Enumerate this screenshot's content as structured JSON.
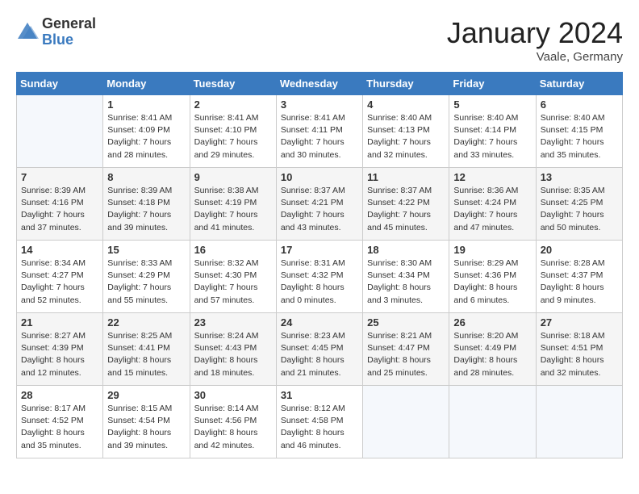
{
  "header": {
    "logo_general": "General",
    "logo_blue": "Blue",
    "month_title": "January 2024",
    "location": "Vaale, Germany"
  },
  "days_of_week": [
    "Sunday",
    "Monday",
    "Tuesday",
    "Wednesday",
    "Thursday",
    "Friday",
    "Saturday"
  ],
  "weeks": [
    [
      {
        "day": "",
        "empty": true
      },
      {
        "day": "1",
        "sunrise": "Sunrise: 8:41 AM",
        "sunset": "Sunset: 4:09 PM",
        "daylight": "Daylight: 7 hours and 28 minutes."
      },
      {
        "day": "2",
        "sunrise": "Sunrise: 8:41 AM",
        "sunset": "Sunset: 4:10 PM",
        "daylight": "Daylight: 7 hours and 29 minutes."
      },
      {
        "day": "3",
        "sunrise": "Sunrise: 8:41 AM",
        "sunset": "Sunset: 4:11 PM",
        "daylight": "Daylight: 7 hours and 30 minutes."
      },
      {
        "day": "4",
        "sunrise": "Sunrise: 8:40 AM",
        "sunset": "Sunset: 4:13 PM",
        "daylight": "Daylight: 7 hours and 32 minutes."
      },
      {
        "day": "5",
        "sunrise": "Sunrise: 8:40 AM",
        "sunset": "Sunset: 4:14 PM",
        "daylight": "Daylight: 7 hours and 33 minutes."
      },
      {
        "day": "6",
        "sunrise": "Sunrise: 8:40 AM",
        "sunset": "Sunset: 4:15 PM",
        "daylight": "Daylight: 7 hours and 35 minutes."
      }
    ],
    [
      {
        "day": "7",
        "sunrise": "Sunrise: 8:39 AM",
        "sunset": "Sunset: 4:16 PM",
        "daylight": "Daylight: 7 hours and 37 minutes."
      },
      {
        "day": "8",
        "sunrise": "Sunrise: 8:39 AM",
        "sunset": "Sunset: 4:18 PM",
        "daylight": "Daylight: 7 hours and 39 minutes."
      },
      {
        "day": "9",
        "sunrise": "Sunrise: 8:38 AM",
        "sunset": "Sunset: 4:19 PM",
        "daylight": "Daylight: 7 hours and 41 minutes."
      },
      {
        "day": "10",
        "sunrise": "Sunrise: 8:37 AM",
        "sunset": "Sunset: 4:21 PM",
        "daylight": "Daylight: 7 hours and 43 minutes."
      },
      {
        "day": "11",
        "sunrise": "Sunrise: 8:37 AM",
        "sunset": "Sunset: 4:22 PM",
        "daylight": "Daylight: 7 hours and 45 minutes."
      },
      {
        "day": "12",
        "sunrise": "Sunrise: 8:36 AM",
        "sunset": "Sunset: 4:24 PM",
        "daylight": "Daylight: 7 hours and 47 minutes."
      },
      {
        "day": "13",
        "sunrise": "Sunrise: 8:35 AM",
        "sunset": "Sunset: 4:25 PM",
        "daylight": "Daylight: 7 hours and 50 minutes."
      }
    ],
    [
      {
        "day": "14",
        "sunrise": "Sunrise: 8:34 AM",
        "sunset": "Sunset: 4:27 PM",
        "daylight": "Daylight: 7 hours and 52 minutes."
      },
      {
        "day": "15",
        "sunrise": "Sunrise: 8:33 AM",
        "sunset": "Sunset: 4:29 PM",
        "daylight": "Daylight: 7 hours and 55 minutes."
      },
      {
        "day": "16",
        "sunrise": "Sunrise: 8:32 AM",
        "sunset": "Sunset: 4:30 PM",
        "daylight": "Daylight: 7 hours and 57 minutes."
      },
      {
        "day": "17",
        "sunrise": "Sunrise: 8:31 AM",
        "sunset": "Sunset: 4:32 PM",
        "daylight": "Daylight: 8 hours and 0 minutes."
      },
      {
        "day": "18",
        "sunrise": "Sunrise: 8:30 AM",
        "sunset": "Sunset: 4:34 PM",
        "daylight": "Daylight: 8 hours and 3 minutes."
      },
      {
        "day": "19",
        "sunrise": "Sunrise: 8:29 AM",
        "sunset": "Sunset: 4:36 PM",
        "daylight": "Daylight: 8 hours and 6 minutes."
      },
      {
        "day": "20",
        "sunrise": "Sunrise: 8:28 AM",
        "sunset": "Sunset: 4:37 PM",
        "daylight": "Daylight: 8 hours and 9 minutes."
      }
    ],
    [
      {
        "day": "21",
        "sunrise": "Sunrise: 8:27 AM",
        "sunset": "Sunset: 4:39 PM",
        "daylight": "Daylight: 8 hours and 12 minutes."
      },
      {
        "day": "22",
        "sunrise": "Sunrise: 8:25 AM",
        "sunset": "Sunset: 4:41 PM",
        "daylight": "Daylight: 8 hours and 15 minutes."
      },
      {
        "day": "23",
        "sunrise": "Sunrise: 8:24 AM",
        "sunset": "Sunset: 4:43 PM",
        "daylight": "Daylight: 8 hours and 18 minutes."
      },
      {
        "day": "24",
        "sunrise": "Sunrise: 8:23 AM",
        "sunset": "Sunset: 4:45 PM",
        "daylight": "Daylight: 8 hours and 21 minutes."
      },
      {
        "day": "25",
        "sunrise": "Sunrise: 8:21 AM",
        "sunset": "Sunset: 4:47 PM",
        "daylight": "Daylight: 8 hours and 25 minutes."
      },
      {
        "day": "26",
        "sunrise": "Sunrise: 8:20 AM",
        "sunset": "Sunset: 4:49 PM",
        "daylight": "Daylight: 8 hours and 28 minutes."
      },
      {
        "day": "27",
        "sunrise": "Sunrise: 8:18 AM",
        "sunset": "Sunset: 4:51 PM",
        "daylight": "Daylight: 8 hours and 32 minutes."
      }
    ],
    [
      {
        "day": "28",
        "sunrise": "Sunrise: 8:17 AM",
        "sunset": "Sunset: 4:52 PM",
        "daylight": "Daylight: 8 hours and 35 minutes."
      },
      {
        "day": "29",
        "sunrise": "Sunrise: 8:15 AM",
        "sunset": "Sunset: 4:54 PM",
        "daylight": "Daylight: 8 hours and 39 minutes."
      },
      {
        "day": "30",
        "sunrise": "Sunrise: 8:14 AM",
        "sunset": "Sunset: 4:56 PM",
        "daylight": "Daylight: 8 hours and 42 minutes."
      },
      {
        "day": "31",
        "sunrise": "Sunrise: 8:12 AM",
        "sunset": "Sunset: 4:58 PM",
        "daylight": "Daylight: 8 hours and 46 minutes."
      },
      {
        "day": "",
        "empty": true
      },
      {
        "day": "",
        "empty": true
      },
      {
        "day": "",
        "empty": true
      }
    ]
  ]
}
